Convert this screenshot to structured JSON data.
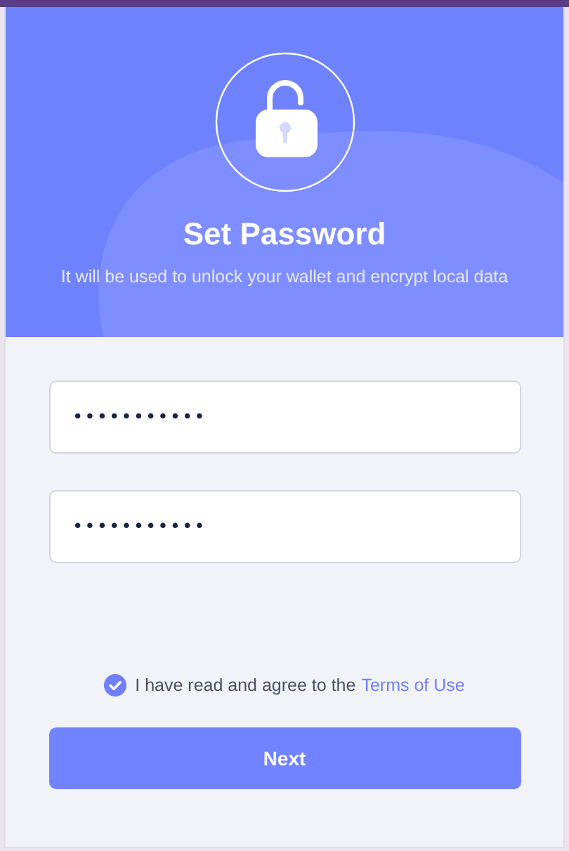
{
  "header": {
    "title": "Set Password",
    "subtitle": "It will be used to unlock your wallet and encrypt local data"
  },
  "fields": [
    {
      "value": "•••••••••••"
    },
    {
      "value": "•••••••••••"
    }
  ],
  "agreement": {
    "checked": true,
    "text": "I have read and agree to the",
    "link": "Terms of Use"
  },
  "button": {
    "label": "Next"
  }
}
